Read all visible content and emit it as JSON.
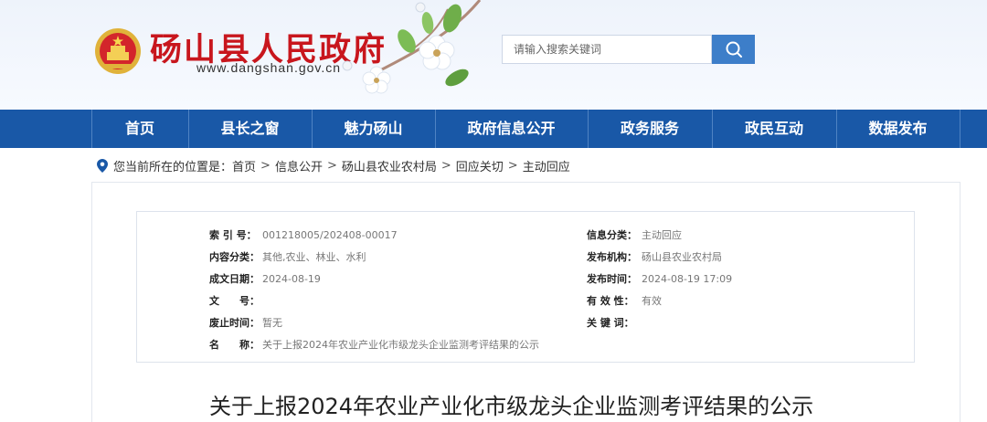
{
  "header": {
    "site_title": "砀山县人民政府",
    "site_url": "www.dangshan.gov.cn",
    "search_placeholder": "请输入搜索关键词"
  },
  "nav": {
    "items": [
      "首页",
      "县长之窗",
      "魅力砀山",
      "政府信息公开",
      "政务服务",
      "政民互动",
      "数据发布"
    ]
  },
  "breadcrumb": {
    "prefix": "您当前所在的位置是：",
    "items": [
      "首页",
      "信息公开",
      "砀山县农业农村局",
      "回应关切",
      "主动回应"
    ],
    "separator": ">"
  },
  "meta": {
    "index_no_label": "索 引 号：",
    "index_no": "001218005/202408-00017",
    "category_label": "信息分类：",
    "category": "主动回应",
    "content_type_label": "内容分类：",
    "content_type": "其他,农业、林业、水利",
    "publisher_label": "发布机构：",
    "publisher": "砀山县农业农村局",
    "created_label": "成文日期：",
    "created": "2024-08-19",
    "published_label": "发布时间：",
    "published": "2024-08-19 17:09",
    "doc_no_label": "文　　号：",
    "doc_no": "",
    "validity_label": "有 效 性：",
    "validity": "有效",
    "expiry_label": "废止时间：",
    "expiry": "暂无",
    "keywords_label": "关 键 词：",
    "keywords": "",
    "name_label": "名　　称：",
    "name": "关于上报2024年农业产业化市级龙头企业监测考评结果的公示"
  },
  "article": {
    "title": "关于上报2024年农业产业化市级龙头企业监测考评结果的公示"
  },
  "colors": {
    "nav_bg": "#1958a7",
    "title_red": "#c8161d",
    "search_btn": "#3d7ec9"
  }
}
